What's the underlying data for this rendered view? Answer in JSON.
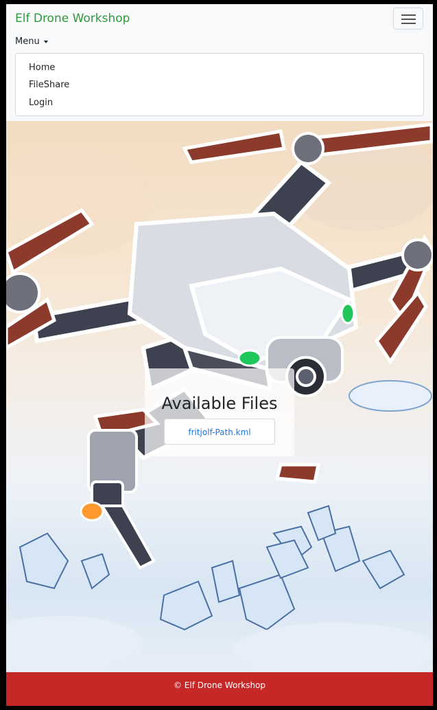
{
  "navbar": {
    "brand": "Elf Drone Workshop",
    "menu_label": "Menu",
    "dropdown_items": [
      {
        "label": "Home"
      },
      {
        "label": "FileShare"
      },
      {
        "label": "Login"
      }
    ]
  },
  "files": {
    "heading": "Available Files",
    "items": [
      {
        "name": "fritjolf-Path.kml"
      }
    ]
  },
  "footer": {
    "text": "© Elf Drone Workshop"
  },
  "colors": {
    "brand": "#2e9a3c",
    "link": "#1a73e8",
    "footer_bg": "#c62828"
  },
  "icons": {
    "toggler": "hamburger-icon",
    "menu_caret": "caret-down-icon"
  }
}
